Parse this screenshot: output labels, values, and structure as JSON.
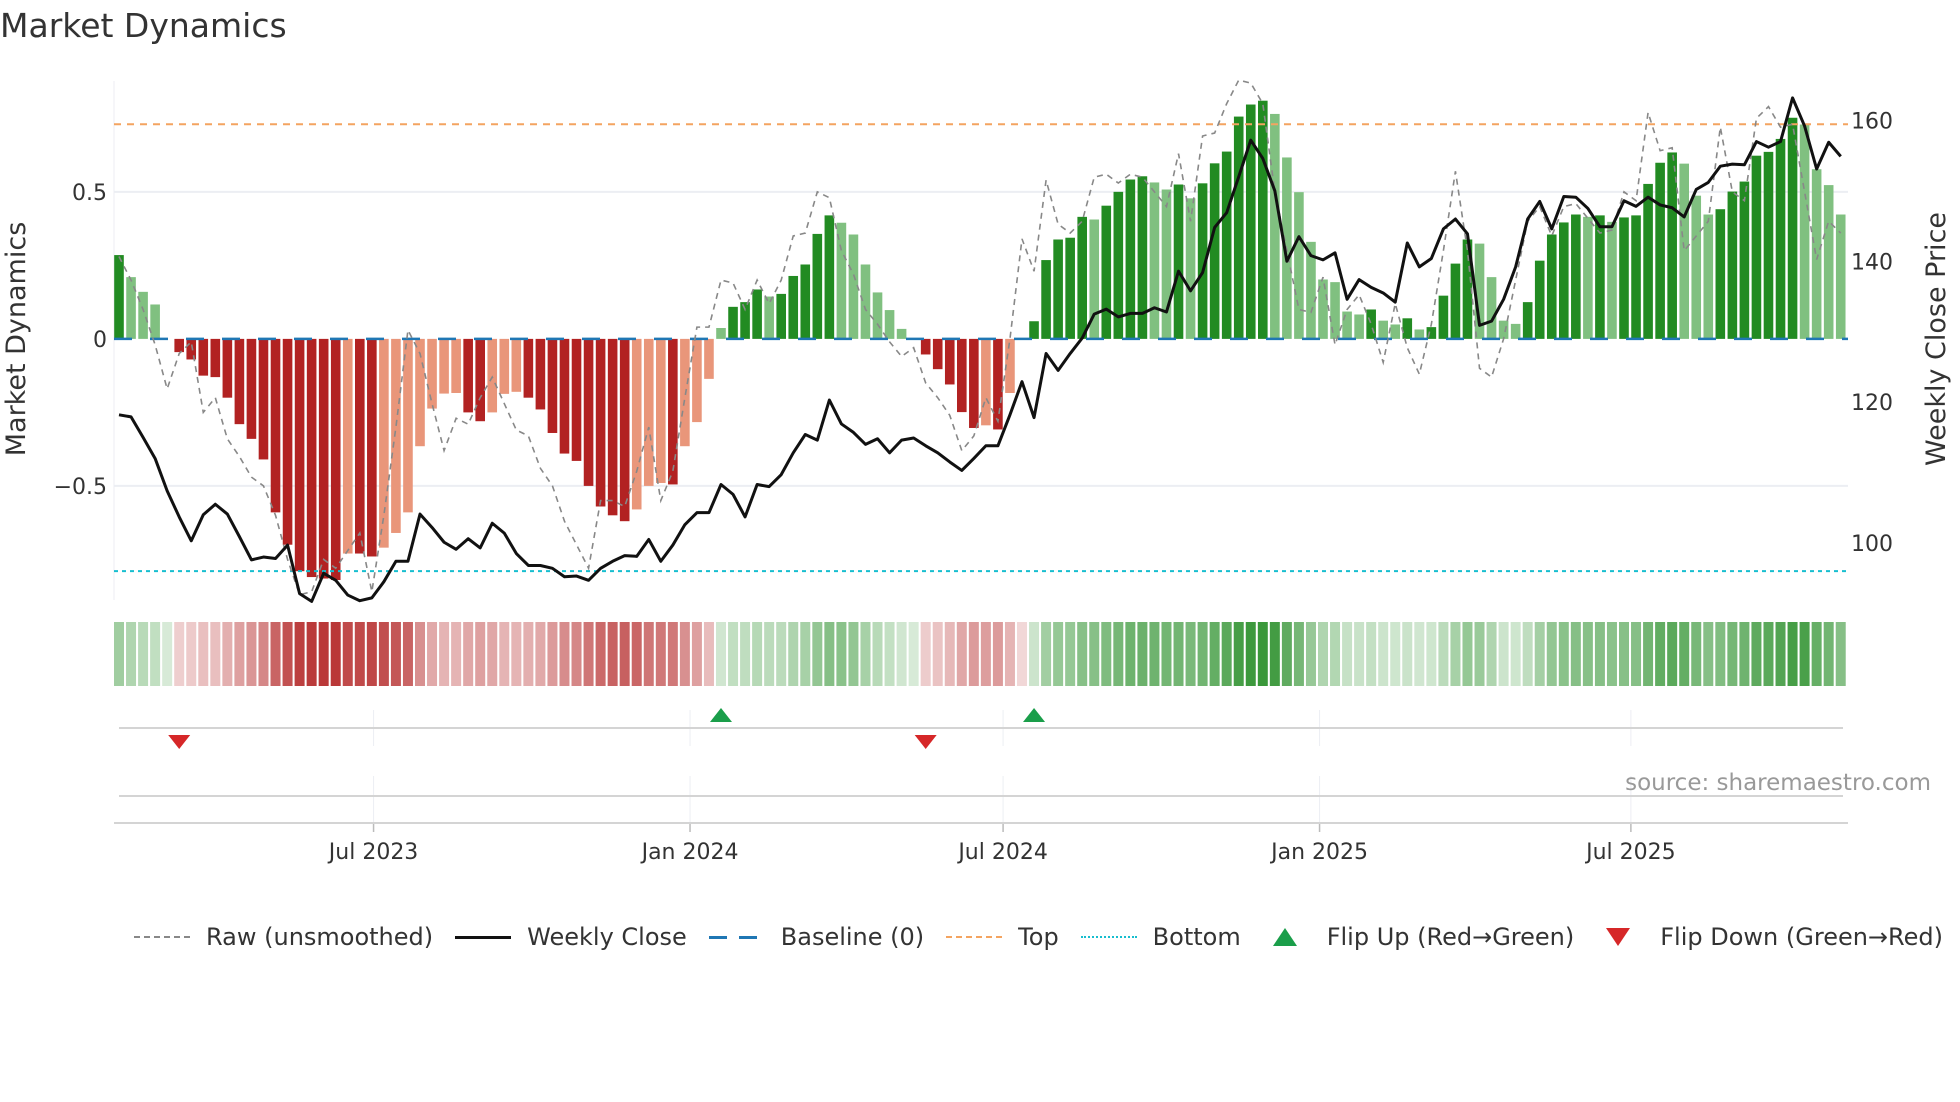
{
  "title": "Market Dynamics",
  "source": "source: sharemaestro.com",
  "legend": {
    "raw": "Raw (unsmoothed)",
    "close": "Weekly Close",
    "baseline": "Baseline (0)",
    "top": "Top",
    "bottom": "Bottom",
    "flip_up": "Flip Up (Red→Green)",
    "flip_down": "Flip Down (Green→Red)"
  },
  "colors": {
    "green_strong": "#228b22",
    "green_weak": "#80c080",
    "red_strong": "#b22222",
    "red_weak": "#e9967a",
    "raw": "#888888",
    "close": "#111111",
    "baseline": "#1f77b4",
    "top": "#f4a460",
    "bottom": "#17becf",
    "flip_up": "#1a9e4a",
    "flip_down": "#d62728"
  },
  "chart_data": {
    "type": "bar",
    "title": "Market Dynamics",
    "ylabel": "Market Dynamics",
    "y2label": "Weekly Close Price",
    "ylim": [
      -0.888,
      0.877
    ],
    "y2lim": [
      91.9,
      165.6
    ],
    "y_ticks": [
      {
        "v": 0.5,
        "label": "0.5"
      },
      {
        "v": 0,
        "label": "0"
      },
      {
        "v": -0.5,
        "label": "−0.5"
      }
    ],
    "y2_ticks": [
      {
        "v": 160,
        "label": "160"
      },
      {
        "v": 140,
        "label": "140"
      },
      {
        "v": 120,
        "label": "120"
      },
      {
        "v": 100,
        "label": "100"
      }
    ],
    "x_start": "2023-02-03",
    "x_step_days": 7,
    "x_ticks": [
      {
        "date": "2023-07-01",
        "label": "Jul 2023"
      },
      {
        "date": "2024-01-01",
        "label": "Jan 2024"
      },
      {
        "date": "2024-07-01",
        "label": "Jul 2024"
      },
      {
        "date": "2025-01-01",
        "label": "Jan 2025"
      },
      {
        "date": "2025-07-01",
        "label": "Jul 2025"
      }
    ],
    "top_level": 0.73,
    "bottom_level": -0.79,
    "baseline": 0,
    "grid": true,
    "legend_position": "bottom",
    "series": [
      {
        "name": "Market Dynamics",
        "values": [
          0.285,
          0.21,
          0.16,
          0.117,
          0.0,
          -0.045,
          -0.07,
          -0.125,
          -0.13,
          -0.2,
          -0.29,
          -0.34,
          -0.41,
          -0.59,
          -0.7,
          -0.79,
          -0.81,
          -0.815,
          -0.82,
          -0.73,
          -0.73,
          -0.74,
          -0.71,
          -0.66,
          -0.59,
          -0.365,
          -0.237,
          -0.186,
          -0.184,
          -0.25,
          -0.28,
          -0.25,
          -0.187,
          -0.18,
          -0.2,
          -0.24,
          -0.32,
          -0.39,
          -0.415,
          -0.5,
          -0.57,
          -0.6,
          -0.62,
          -0.58,
          -0.5,
          -0.49,
          -0.495,
          -0.365,
          -0.283,
          -0.136,
          0.037,
          0.109,
          0.125,
          0.168,
          0.144,
          0.153,
          0.214,
          0.253,
          0.357,
          0.42,
          0.395,
          0.355,
          0.253,
          0.158,
          0.098,
          0.034,
          0.0,
          -0.053,
          -0.103,
          -0.155,
          -0.249,
          -0.303,
          -0.294,
          -0.308,
          -0.184,
          0.0,
          0.06,
          0.268,
          0.338,
          0.344,
          0.415,
          0.406,
          0.453,
          0.5,
          0.542,
          0.553,
          0.532,
          0.508,
          0.525,
          0.478,
          0.529,
          0.597,
          0.637,
          0.756,
          0.797,
          0.81,
          0.765,
          0.617,
          0.499,
          0.33,
          0.202,
          0.193,
          0.093,
          0.083,
          0.1,
          0.062,
          0.049,
          0.07,
          0.032,
          0.04,
          0.147,
          0.256,
          0.338,
          0.324,
          0.21,
          0.062,
          0.051,
          0.125,
          0.266,
          0.355,
          0.396,
          0.423,
          0.415,
          0.42,
          0.398,
          0.413,
          0.42,
          0.527,
          0.599,
          0.634,
          0.596,
          0.487,
          0.423,
          0.441,
          0.501,
          0.535,
          0.623,
          0.636,
          0.68,
          0.752,
          0.729,
          0.577,
          0.523,
          0.423
        ]
      },
      {
        "name": "Raw (unsmoothed)",
        "values": [
          0.28,
          0.2,
          0.1,
          -0.02,
          -0.17,
          -0.05,
          -0.01,
          -0.25,
          -0.2,
          -0.34,
          -0.4,
          -0.47,
          -0.5,
          -0.6,
          -0.75,
          -0.87,
          -0.86,
          -0.75,
          -0.78,
          -0.72,
          -0.66,
          -0.86,
          -0.6,
          -0.3,
          0.03,
          -0.05,
          -0.22,
          -0.38,
          -0.27,
          -0.29,
          -0.2,
          -0.13,
          -0.22,
          -0.31,
          -0.33,
          -0.44,
          -0.5,
          -0.62,
          -0.7,
          -0.78,
          -0.55,
          -0.55,
          -0.57,
          -0.45,
          -0.3,
          -0.55,
          -0.45,
          -0.2,
          0.04,
          0.04,
          0.2,
          0.19,
          0.1,
          0.2,
          0.12,
          0.2,
          0.35,
          0.36,
          0.5,
          0.48,
          0.3,
          0.22,
          0.1,
          0.05,
          -0.01,
          -0.06,
          -0.03,
          -0.15,
          -0.2,
          -0.26,
          -0.38,
          -0.33,
          -0.2,
          -0.28,
          0.0,
          0.34,
          0.23,
          0.54,
          0.39,
          0.36,
          0.4,
          0.55,
          0.56,
          0.53,
          0.56,
          0.55,
          0.5,
          0.45,
          0.63,
          0.4,
          0.69,
          0.7,
          0.8,
          0.88,
          0.87,
          0.8,
          0.5,
          0.3,
          0.1,
          0.09,
          0.21,
          -0.02,
          0.1,
          0.15,
          0.05,
          -0.08,
          0.12,
          -0.03,
          -0.12,
          0.05,
          0.3,
          0.57,
          0.3,
          -0.1,
          -0.13,
          0.0,
          0.2,
          0.4,
          0.45,
          0.35,
          0.45,
          0.46,
          0.41,
          0.36,
          0.37,
          0.5,
          0.47,
          0.77,
          0.64,
          0.65,
          0.3,
          0.35,
          0.4,
          0.72,
          0.5,
          0.47,
          0.75,
          0.79,
          0.72,
          0.73,
          0.5,
          0.27,
          0.4,
          0.36
        ]
      },
      {
        "name": "Weekly Close",
        "axis": "right",
        "values": [
          118.2,
          117.9,
          115,
          112,
          107.4,
          103.7,
          100.3,
          104,
          105.5,
          104.1,
          100.9,
          97.6,
          98,
          97.8,
          99.7,
          92.8,
          91.7,
          95.7,
          94.7,
          92.6,
          91.8,
          92.2,
          94.5,
          97.4,
          97.4,
          104.1,
          102.2,
          100.1,
          99.1,
          100.6,
          99.3,
          102.8,
          101.4,
          98.5,
          96.8,
          96.8,
          96.4,
          95.2,
          95.3,
          94.7,
          96.4,
          97.4,
          98.2,
          98.1,
          100.5,
          97.4,
          99.7,
          102.6,
          104.3,
          104.3,
          108.3,
          106.9,
          103.7,
          108.3,
          108,
          109.7,
          112.8,
          115.4,
          114.6,
          120.3,
          116.9,
          115.7,
          114,
          114.8,
          112.8,
          114.6,
          114.9,
          113.8,
          112.8,
          111.5,
          110.3,
          112,
          113.8,
          113.8,
          118.2,
          122.9,
          117.8,
          126.9,
          124.5,
          126.9,
          129.1,
          132.5,
          133.2,
          132.1,
          132.6,
          132.6,
          133.4,
          132.8,
          138.6,
          135.8,
          138.4,
          144.8,
          146.9,
          152,
          157.2,
          154.6,
          150,
          140,
          143.5,
          140.8,
          140.2,
          141.2,
          134.6,
          137.4,
          136.3,
          135.5,
          134.2,
          142.6,
          139.2,
          140.4,
          144.6,
          146,
          143.9,
          130.9,
          131.5,
          134.6,
          139.2,
          146,
          148.5,
          144.6,
          149.2,
          149.1,
          147.5,
          144.9,
          144.9,
          148.6,
          147.8,
          149.1,
          148,
          147.6,
          146.3,
          150.2,
          151.2,
          153.5,
          153.8,
          153.7,
          157,
          156.2,
          157,
          163.2,
          159.2,
          153.1,
          156.9,
          154.9
        ]
      }
    ]
  }
}
